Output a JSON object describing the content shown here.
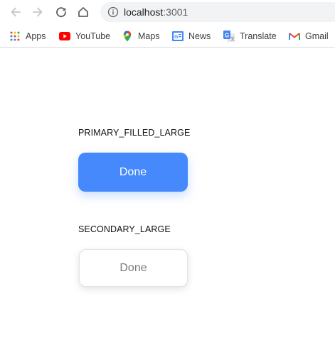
{
  "browser": {
    "url_host": "localhost",
    "url_port": ":3001",
    "bookmarks": [
      {
        "label": "Apps",
        "icon": "apps-grid-icon"
      },
      {
        "label": "YouTube",
        "icon": "youtube-icon"
      },
      {
        "label": "Maps",
        "icon": "maps-pin-icon"
      },
      {
        "label": "News",
        "icon": "news-icon"
      },
      {
        "label": "Translate",
        "icon": "translate-icon"
      },
      {
        "label": "Gmail",
        "icon": "gmail-icon"
      }
    ]
  },
  "page": {
    "sections": [
      {
        "label": "PRIMARY_FILLED_LARGE",
        "button_text": "Done",
        "variant": "primary-filled"
      },
      {
        "label": "SECONDARY_LARGE",
        "button_text": "Done",
        "variant": "secondary"
      }
    ]
  },
  "colors": {
    "primary": "#4589fc",
    "secondary_text": "#7a7a7a"
  }
}
